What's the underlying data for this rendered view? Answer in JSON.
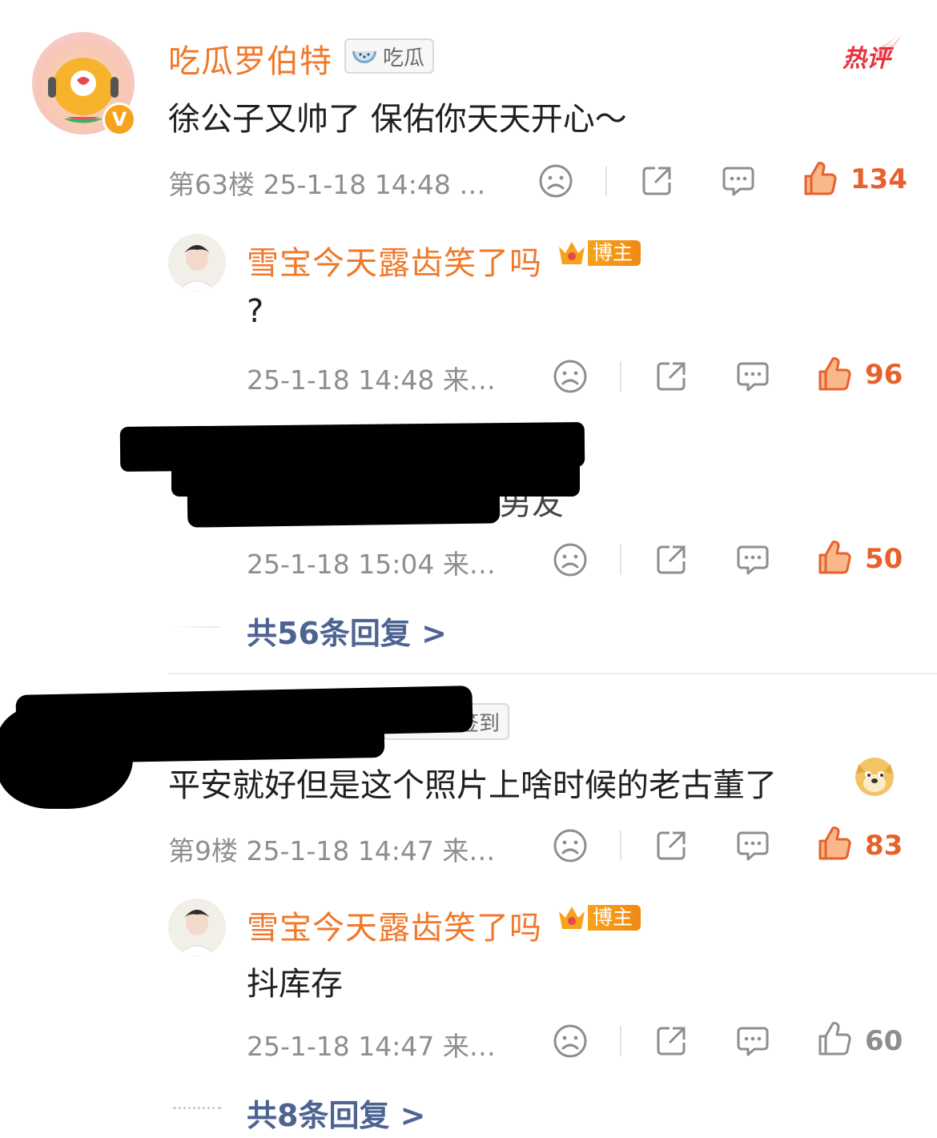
{
  "hot_label": "热评",
  "comments": [
    {
      "author": "吃瓜罗伯特",
      "badge": "吃瓜",
      "text": "徐公子又帅了 保佑你天天开心～",
      "meta": "第63楼 25-1-18 14:48 …",
      "likes": "134",
      "replies": [
        {
          "author": "雪宝今天露齿笑了吗",
          "badge": "博主",
          "text": "?",
          "meta": "25-1-18 14:48 来…",
          "likes": "96"
        },
        {
          "text_visible_fragment": "男友",
          "meta": "25-1-18 15:04 来…",
          "likes": "50"
        }
      ],
      "more_replies": "共56条回复 >"
    },
    {
      "badge": "超话签到",
      "text": "平安就好但是这个照片上啥时候的老古董了",
      "meta": "第9楼 25-1-18 14:47 来…",
      "likes": "83",
      "replies": [
        {
          "author": "雪宝今天露齿笑了吗",
          "badge": "博主",
          "text": "抖库存",
          "meta": "25-1-18 14:47 来…",
          "likes": "60"
        }
      ],
      "more_replies": "共8条回复 >"
    }
  ],
  "colors": {
    "author_orange": "#f0782a",
    "like_hot": "#e8602c",
    "link_blue": "#4d6391"
  },
  "icons": [
    "sad-face-icon",
    "share-icon",
    "comment-icon",
    "thumbs-up-icon",
    "verified-v-icon",
    "watermelon-icon",
    "crown-icon",
    "doge-emoji-icon"
  ]
}
